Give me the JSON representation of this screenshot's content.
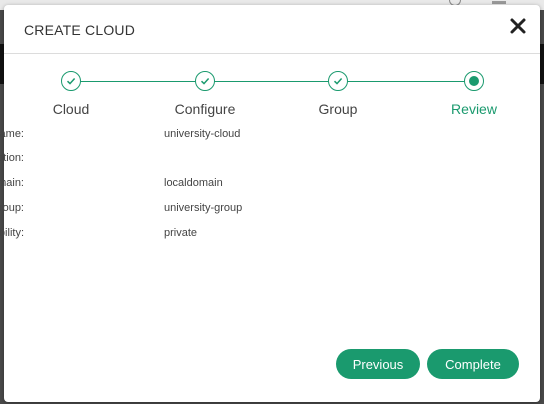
{
  "modal": {
    "title": "CREATE CLOUD"
  },
  "wizard": {
    "steps": [
      {
        "label": "Cloud",
        "state": "done"
      },
      {
        "label": "Configure",
        "state": "done"
      },
      {
        "label": "Group",
        "state": "done"
      },
      {
        "label": "Review",
        "state": "active"
      }
    ]
  },
  "review": [
    {
      "key": "Name:",
      "value": "university-cloud"
    },
    {
      "key": "Location:",
      "value": ""
    },
    {
      "key": "Domain:",
      "value": "localdomain"
    },
    {
      "key": "Group:",
      "value": "university-group"
    },
    {
      "key": "Visibility:",
      "value": "private"
    }
  ],
  "buttons": {
    "previous": "Previous",
    "complete": "Complete"
  },
  "colors": {
    "accent": "#1a9a6e"
  }
}
